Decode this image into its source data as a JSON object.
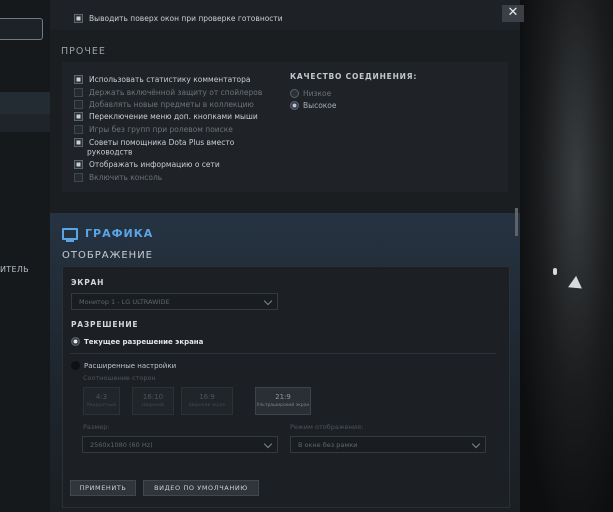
{
  "sidebar": {
    "partial_label": "ИТЕЛЬ"
  },
  "window": {
    "close_glyph": "✕"
  },
  "top_option": {
    "label": "Выводить поверх окон при проверке готовности",
    "checked": true
  },
  "other": {
    "title": "ПРОЧЕЕ",
    "options": [
      {
        "label": "Использовать статистику комментатора",
        "checked": true,
        "enabled": true
      },
      {
        "label": "Держать включённой защиту от спойлеров",
        "checked": false,
        "enabled": false
      },
      {
        "label": "Добавлять новые предметы в коллекцию",
        "checked": false,
        "enabled": false
      },
      {
        "label": "Переключение меню доп. кнопками мыши",
        "checked": true,
        "enabled": true
      },
      {
        "label": "Игры без групп при ролевом поиске",
        "checked": false,
        "enabled": false
      },
      {
        "label": "Советы помощника Dota Plus вместо",
        "label2": "руководств",
        "checked": true,
        "enabled": true
      },
      {
        "label": "Отображать информацию о сети",
        "checked": true,
        "enabled": true
      },
      {
        "label": "Включить консоль",
        "checked": false,
        "enabled": false
      }
    ],
    "connection": {
      "title": "КАЧЕСТВО СОЕДИНЕНИЯ:",
      "options": [
        {
          "label": "Низкое",
          "selected": false
        },
        {
          "label": "Высокое",
          "selected": true
        }
      ]
    }
  },
  "graphics": {
    "title": "ГРАФИКА",
    "display_title": "ОТОБРАЖЕНИЕ",
    "screen": {
      "title": "ЭКРАН",
      "value": "Монитор 1 - LG ULTRAWIDE"
    },
    "resolution": {
      "title": "РАЗРЕШЕНИЕ",
      "current": "Текущее разрешение экрана",
      "advanced": "Расширенные настройки",
      "aspect_label": "Соотношение сторон",
      "aspects": [
        {
          "ratio": "4:3",
          "desc": "Квадратный",
          "selected": false
        },
        {
          "ratio": "16:10",
          "desc": "Широкий",
          "selected": false
        },
        {
          "ratio": "16:9",
          "desc": "Широкий экран",
          "selected": false
        },
        {
          "ratio": "21:9",
          "desc": "Ультраширокий экран",
          "selected": true
        }
      ],
      "size_label": "Размер:",
      "size_value": "2560x1080 (60 Hz)",
      "mode_label": "Режим отображения:",
      "mode_value": "В окне без рамки"
    },
    "buttons": {
      "apply": "ПРИМЕНИТЬ",
      "default": "ВИДЕО ПО УМОЛЧАНИЮ"
    }
  },
  "colors": {
    "accent": "#5aa5e6",
    "panel": "#1b1e21"
  }
}
